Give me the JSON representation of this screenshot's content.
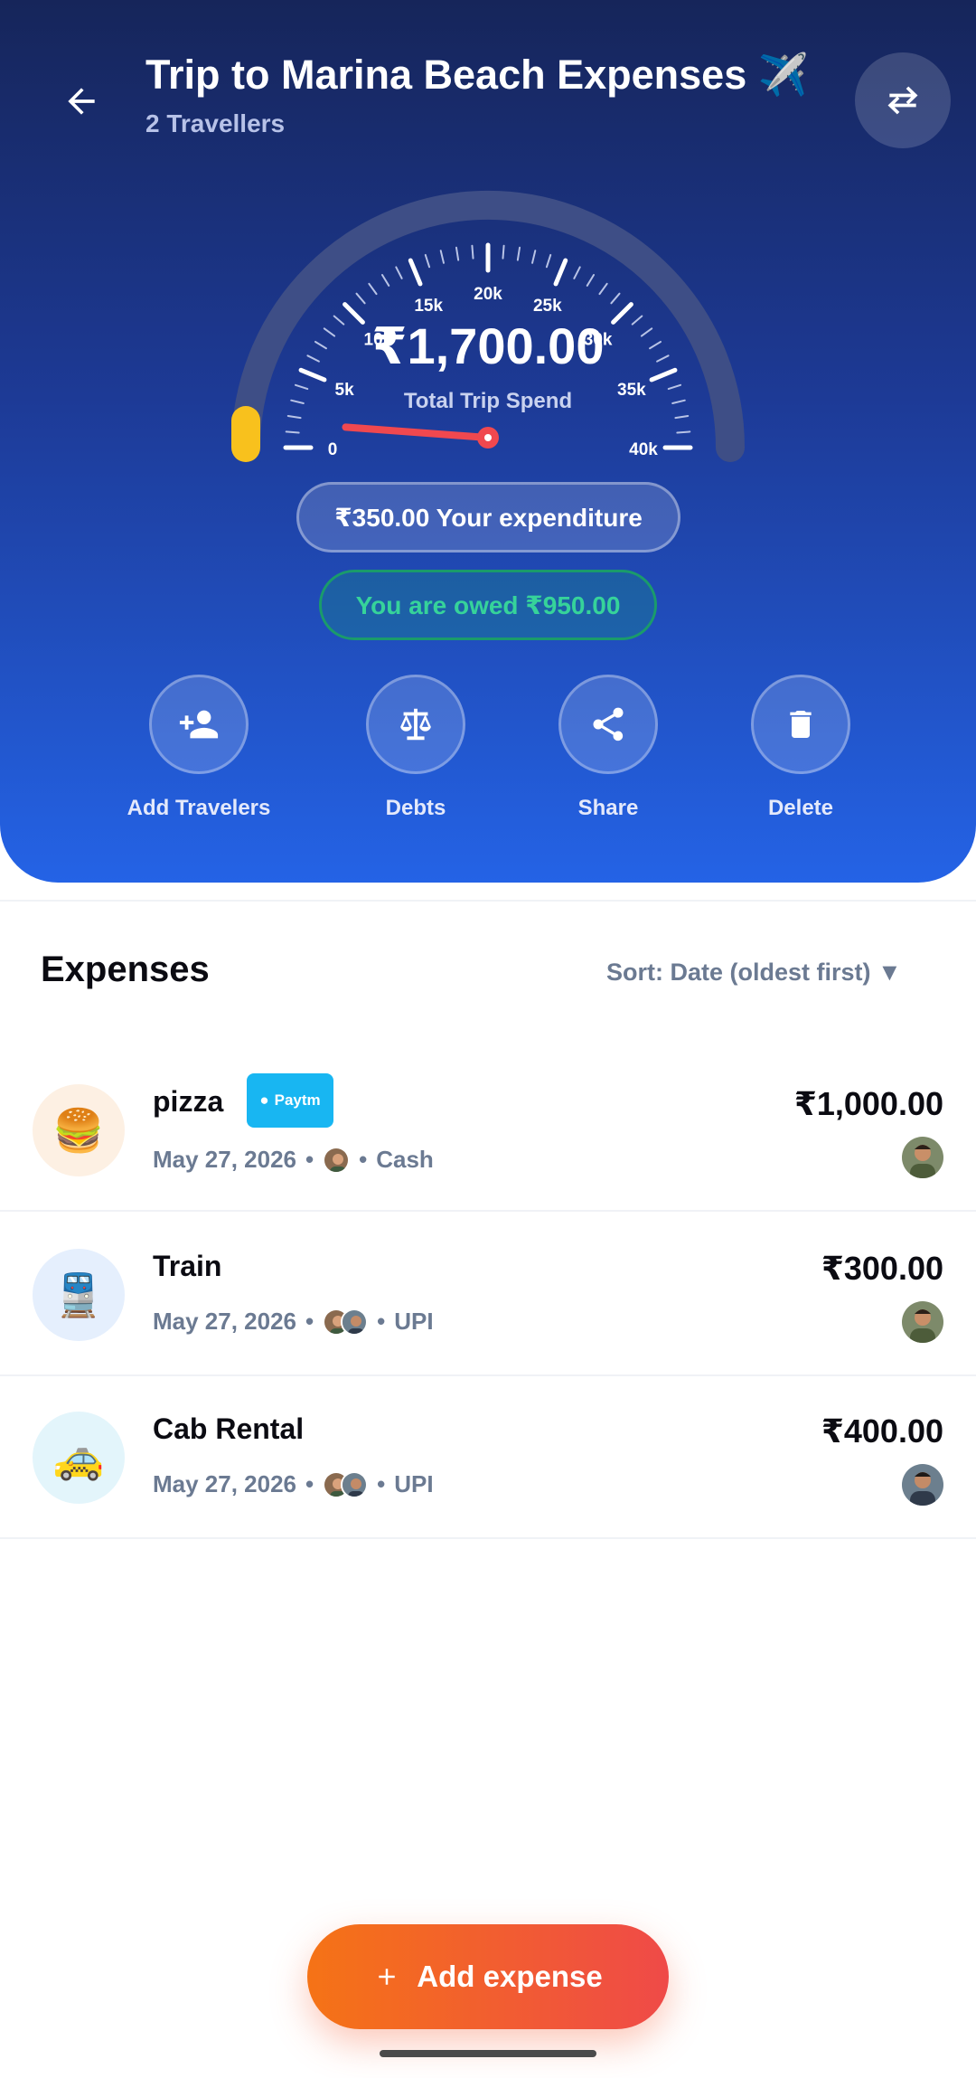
{
  "header": {
    "title": "Trip to Marina Beach Expenses ✈️",
    "subtitle": "2 Travellers"
  },
  "gauge": {
    "amount": "₹1,700.00",
    "label": "Total Trip Spend",
    "value": 1700,
    "min": 0,
    "max": 40000,
    "ticks": [
      "0",
      "5k",
      "10k",
      "15k",
      "20k",
      "25k",
      "30k",
      "35k",
      "40k"
    ],
    "colors": {
      "track": "#3e4e86",
      "needle": "#f0484f",
      "progress": "#f8c11d"
    }
  },
  "expenditure": "₹350.00 Your expenditure",
  "owed": "You are owed ₹950.00",
  "actions": [
    {
      "label": "Add Travelers",
      "icon": "add-person-icon"
    },
    {
      "label": "Debts",
      "icon": "scale-icon"
    },
    {
      "label": "Share",
      "icon": "share-icon"
    },
    {
      "label": "Delete",
      "icon": "trash-icon"
    }
  ],
  "expenses_section": {
    "title": "Expenses",
    "sort_label": "Sort: Date (oldest first) ▼"
  },
  "expenses": [
    {
      "name": "pizza",
      "emoji": "🍔",
      "date": "May 27, 2026",
      "method": "Cash",
      "amount": "₹1,000.00",
      "badge": "Paytm",
      "icon_bg": "#fdf0e3"
    },
    {
      "name": "Train",
      "emoji": "🚆",
      "date": "May 27, 2026",
      "method": "UPI",
      "amount": "₹300.00",
      "icon_bg": "#e5effd"
    },
    {
      "name": "Cab Rental",
      "emoji": "🚕",
      "date": "May 27, 2026",
      "method": "UPI",
      "amount": "₹400.00",
      "icon_bg": "#e3f5fb"
    }
  ],
  "fab": {
    "label": "Add expense"
  },
  "colors": {
    "accent": "#2463e6",
    "owed_green": "#36d39a",
    "fab_start": "#f57316",
    "fab_end": "#ef4a48"
  }
}
